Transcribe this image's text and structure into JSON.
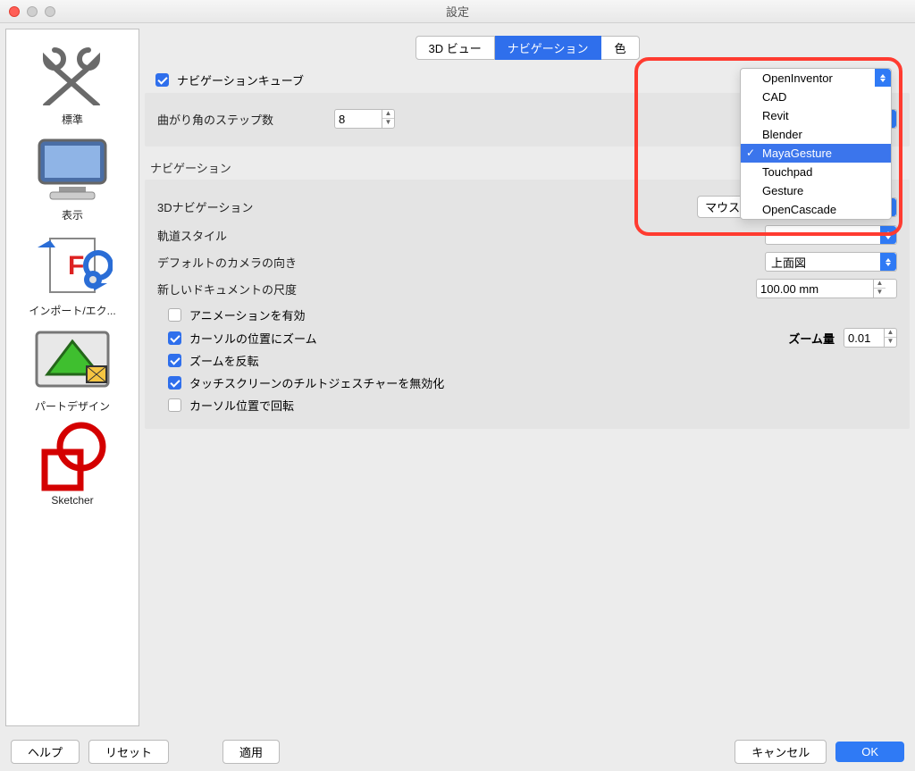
{
  "window": {
    "title": "設定"
  },
  "sidebar": {
    "items": [
      {
        "label": "標準"
      },
      {
        "label": "表示"
      },
      {
        "label": "インポート/エク..."
      },
      {
        "label": "パートデザイン"
      },
      {
        "label": "Sketcher"
      }
    ]
  },
  "tabs": [
    {
      "label": "3D ビュー",
      "active": false
    },
    {
      "label": "ナビゲーション",
      "active": true
    },
    {
      "label": "色",
      "active": false
    }
  ],
  "sections": {
    "navcube": {
      "checkbox_label": "ナビゲーションキューブ",
      "checked": true,
      "steps_label": "曲がり角のステップ数",
      "steps_value": "8"
    },
    "navigation": {
      "heading": "ナビゲーション",
      "nav3d_label": "3Dナビゲーション",
      "nav3d_mousebtn": "マウス...",
      "nav3d_selected": "MayaGesture",
      "orbit_label": "軌道スタイル",
      "orbit_value": "",
      "camdir_label": "デフォルトのカメラの向き",
      "camdir_value": "上面図",
      "newdoc_label": "新しいドキュメントの尺度",
      "newdoc_value": "100.00 mm",
      "checks": [
        {
          "label": "アニメーションを有効",
          "checked": false
        },
        {
          "label": "カーソルの位置にズーム",
          "checked": true
        },
        {
          "label": "ズームを反転",
          "checked": true
        },
        {
          "label": "タッチスクリーンのチルトジェスチャーを無効化",
          "checked": true
        },
        {
          "label": "カーソル位置で回転",
          "checked": false
        }
      ],
      "zoom_amount_label": "ズーム量",
      "zoom_amount_value": "0.01"
    }
  },
  "dropdown": {
    "options": [
      "OpenInventor",
      "CAD",
      "Revit",
      "Blender",
      "MayaGesture",
      "Touchpad",
      "Gesture",
      "OpenCascade"
    ],
    "selected": "MayaGesture"
  },
  "buttons": {
    "help": "ヘルプ",
    "reset": "リセット",
    "apply": "適用",
    "cancel": "キャンセル",
    "ok": "OK"
  }
}
